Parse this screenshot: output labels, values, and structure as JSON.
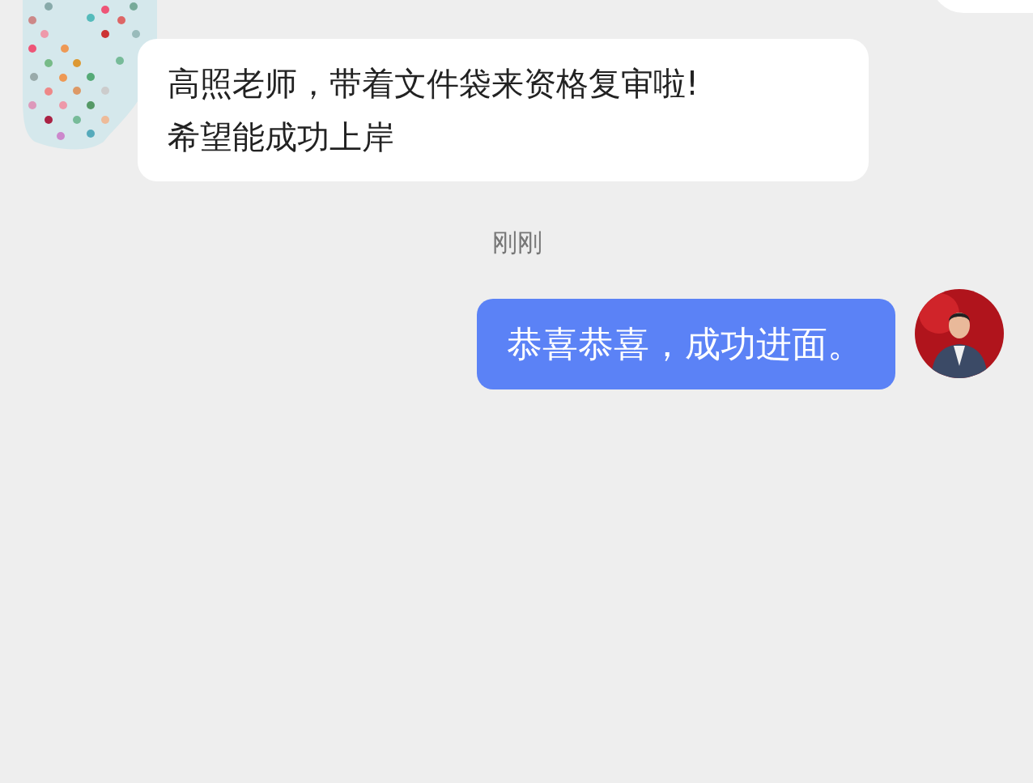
{
  "messages": [
    {
      "kind": "incoming",
      "lines": [
        "高照老师，带着文件袋来资格复审啦!",
        "希望能成功上岸"
      ]
    },
    {
      "kind": "time",
      "text": "刚刚"
    },
    {
      "kind": "outgoing",
      "lines": [
        "恭喜恭喜，成功进面。"
      ]
    }
  ]
}
